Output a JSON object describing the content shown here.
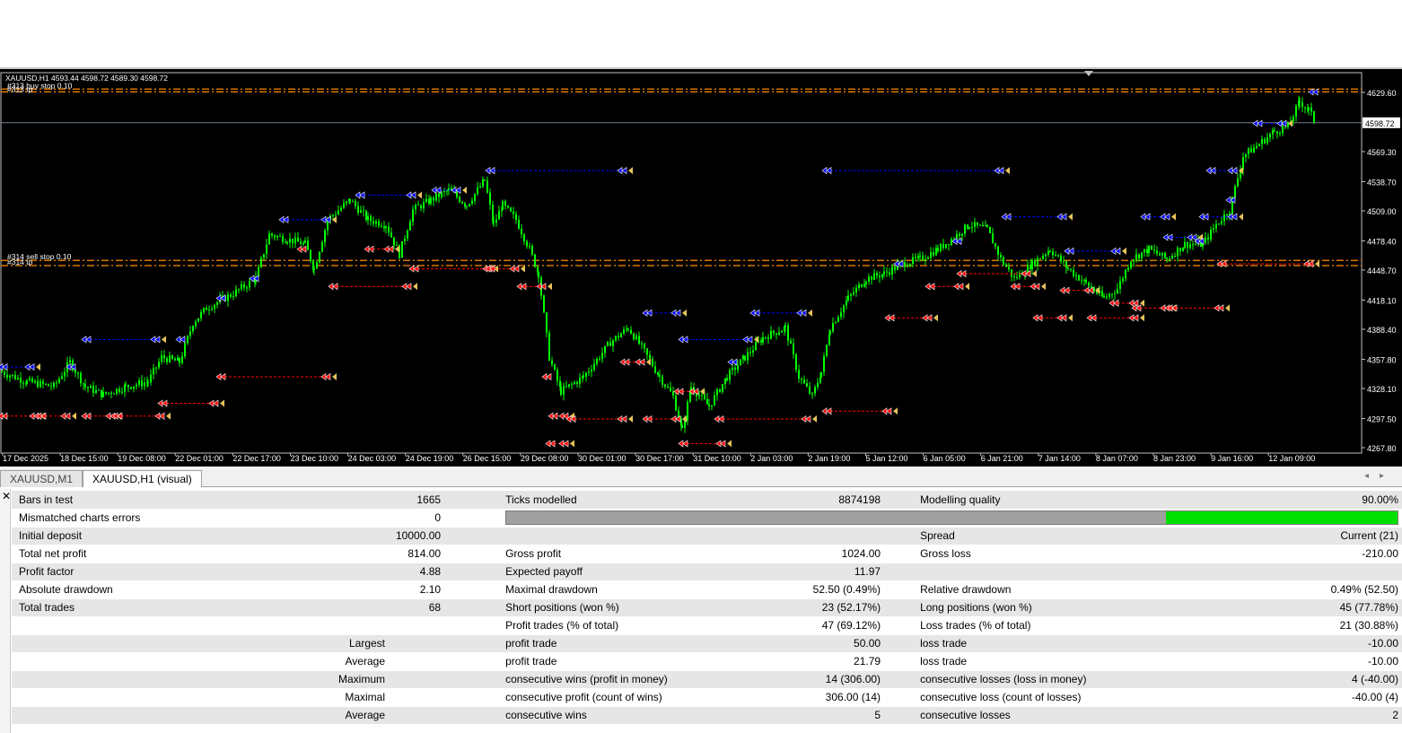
{
  "chart": {
    "header_symbol": "XAUUSD,H1",
    "header_prices": "4593.44 4598.72 4589.30 4598.72",
    "order_label_top": "#313 buy stop 0.10",
    "order_label_top_tp": "#313 tp",
    "order_label_mid": "#314 sell stop 0.10",
    "order_label_mid_tp": "#314 tp",
    "current_price": "4598.72",
    "price_axis": [
      "4629.60",
      "4569.30",
      "4538.70",
      "4509.00",
      "4478.40",
      "4448.70",
      "4418.10",
      "4388.40",
      "4357.80",
      "4328.10",
      "4297.50",
      "4267.80"
    ],
    "time_axis": [
      "17 Dec 2025",
      "18 Dec 15:00",
      "19 Dec 08:00",
      "22 Dec 01:00",
      "22 Dec 17:00",
      "23 Dec 10:00",
      "24 Dec 03:00",
      "24 Dec 19:00",
      "26 Dec 15:00",
      "29 Dec 08:00",
      "30 Dec 01:00",
      "30 Dec 17:00",
      "31 Dec 10:00",
      "2 Jan 03:00",
      "2 Jan 19:00",
      "5 Jan 12:00",
      "6 Jan 05:00",
      "6 Jan 21:00",
      "7 Jan 14:00",
      "8 Jan 07:00",
      "8 Jan 23:00",
      "9 Jan 16:00",
      "12 Jan 09:00"
    ],
    "colors": {
      "background": "#000000",
      "candle_up": "#00ff00",
      "candle_down": "#00ff00",
      "order_line": "#ff8c00",
      "sell_line": "#ff0000",
      "buy_line": "#0000ff",
      "price_line": "#708090"
    }
  },
  "tabs": [
    {
      "label": "XAUUSD,M1",
      "active": false
    },
    {
      "label": "XAUUSD,H1 (visual)",
      "active": true
    }
  ],
  "report": {
    "close_icon": "✕",
    "rows": [
      [
        "Bars in test",
        "1665",
        "Ticks modelled",
        "8874198",
        "Modelling quality",
        "90.00%"
      ],
      [
        "Mismatched charts errors",
        "0",
        "",
        "",
        "",
        ""
      ],
      [
        "Initial deposit",
        "10000.00",
        "",
        "",
        "Spread",
        "Current (21)"
      ],
      [
        "Total net profit",
        "814.00",
        "Gross profit",
        "1024.00",
        "Gross loss",
        "-210.00"
      ],
      [
        "Profit factor",
        "4.88",
        "Expected payoff",
        "11.97",
        "",
        ""
      ],
      [
        "Absolute drawdown",
        "2.10",
        "Maximal drawdown",
        "52.50 (0.49%)",
        "Relative drawdown",
        "0.49% (52.50)"
      ],
      [
        "Total trades",
        "68",
        "Short positions (won %)",
        "23 (52.17%)",
        "Long positions (won %)",
        "45 (77.78%)"
      ],
      [
        "",
        "",
        "Profit trades (% of total)",
        "47 (69.12%)",
        "Loss trades (% of total)",
        "21 (30.88%)"
      ],
      [
        "Largest",
        "",
        "profit trade",
        "50.00",
        "loss trade",
        "-10.00"
      ],
      [
        "Average",
        "",
        "profit trade",
        "21.79",
        "loss trade",
        "-10.00"
      ],
      [
        "Maximum",
        "",
        "consecutive wins (profit in money)",
        "14 (306.00)",
        "consecutive losses (loss in money)",
        "4 (-40.00)"
      ],
      [
        "Maximal",
        "",
        "consecutive profit (count of wins)",
        "306.00 (14)",
        "consecutive loss (count of losses)",
        "-40.00 (4)"
      ],
      [
        "Average",
        "",
        "consecutive wins",
        "5",
        "consecutive losses",
        "2"
      ]
    ],
    "modelling_quality_fraction": 0.26
  }
}
